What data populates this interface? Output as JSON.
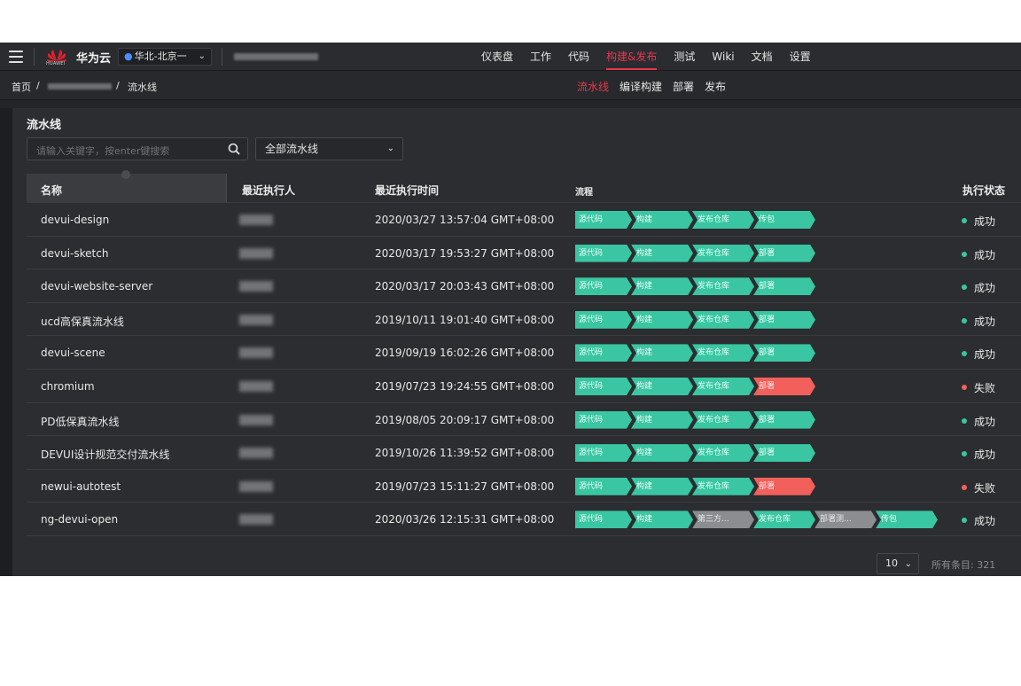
{
  "topbar": {
    "brand": "华为云",
    "logo_text": "HUAWEI",
    "region": "华北-北京一",
    "nav": [
      {
        "label": "仪表盘",
        "active": false
      },
      {
        "label": "工作",
        "active": false
      },
      {
        "label": "代码",
        "active": false
      },
      {
        "label": "构建&发布",
        "active": true
      },
      {
        "label": "测试",
        "active": false
      },
      {
        "label": "Wiki",
        "active": false
      },
      {
        "label": "文档",
        "active": false
      },
      {
        "label": "设置",
        "active": false
      }
    ]
  },
  "breadcrumb": {
    "home": "首页",
    "sep": "/",
    "current": "流水线"
  },
  "subnav": [
    {
      "label": "流水线",
      "active": true
    },
    {
      "label": "编译构建",
      "active": false
    },
    {
      "label": "部署",
      "active": false
    },
    {
      "label": "发布",
      "active": false
    }
  ],
  "panel": {
    "title": "流水线",
    "search_placeholder": "请输入关键字，按enter键搜索",
    "filter_value": "全部流水线"
  },
  "table": {
    "headers": {
      "name": "名称",
      "executor": "最近执行人",
      "time": "最近执行时间",
      "flow": "流程",
      "status": "执行状态"
    },
    "rows": [
      {
        "name": "devui-design",
        "time": "2020/03/27 13:57:04 GMT+08:00",
        "stages": [
          [
            "源代码",
            "ok"
          ],
          [
            "构建",
            "ok"
          ],
          [
            "发布仓库",
            "ok"
          ],
          [
            "传包",
            "ok"
          ]
        ],
        "status": "成功",
        "ok": true
      },
      {
        "name": "devui-sketch",
        "time": "2020/03/17 19:53:27 GMT+08:00",
        "stages": [
          [
            "源代码",
            "ok"
          ],
          [
            "构建",
            "ok"
          ],
          [
            "发布仓库",
            "ok"
          ],
          [
            "部署",
            "ok"
          ]
        ],
        "status": "成功",
        "ok": true
      },
      {
        "name": "devui-website-server",
        "time": "2020/03/17 20:03:43 GMT+08:00",
        "stages": [
          [
            "源代码",
            "ok"
          ],
          [
            "构建",
            "ok"
          ],
          [
            "发布仓库",
            "ok"
          ],
          [
            "部署",
            "ok"
          ]
        ],
        "status": "成功",
        "ok": true
      },
      {
        "name": "ucd高保真流水线",
        "time": "2019/10/11 19:01:40 GMT+08:00",
        "stages": [
          [
            "源代码",
            "ok"
          ],
          [
            "构建",
            "ok"
          ],
          [
            "发布仓库",
            "ok"
          ],
          [
            "部署",
            "ok"
          ]
        ],
        "status": "成功",
        "ok": true
      },
      {
        "name": "devui-scene",
        "time": "2019/09/19 16:02:26 GMT+08:00",
        "stages": [
          [
            "源代码",
            "ok"
          ],
          [
            "构建",
            "ok"
          ],
          [
            "发布仓库",
            "ok"
          ],
          [
            "部署",
            "ok"
          ]
        ],
        "status": "成功",
        "ok": true
      },
      {
        "name": "chromium",
        "time": "2019/07/23 19:24:55 GMT+08:00",
        "stages": [
          [
            "源代码",
            "ok"
          ],
          [
            "构建",
            "ok"
          ],
          [
            "发布仓库",
            "ok"
          ],
          [
            "部署",
            "fail"
          ]
        ],
        "status": "失败",
        "ok": false
      },
      {
        "name": "PD低保真流水线",
        "time": "2019/08/05 20:09:17 GMT+08:00",
        "stages": [
          [
            "源代码",
            "ok"
          ],
          [
            "构建",
            "ok"
          ],
          [
            "发布仓库",
            "ok"
          ],
          [
            "部署",
            "ok"
          ]
        ],
        "status": "成功",
        "ok": true
      },
      {
        "name": "DEVUI设计规范交付流水线",
        "time": "2019/10/26 11:39:52 GMT+08:00",
        "stages": [
          [
            "源代码",
            "ok"
          ],
          [
            "构建",
            "ok"
          ],
          [
            "发布仓库",
            "ok"
          ],
          [
            "部署",
            "ok"
          ]
        ],
        "status": "成功",
        "ok": true
      },
      {
        "name": "newui-autotest",
        "time": "2019/07/23 15:11:27 GMT+08:00",
        "stages": [
          [
            "源代码",
            "ok"
          ],
          [
            "构建",
            "ok"
          ],
          [
            "发布仓库",
            "ok"
          ],
          [
            "部署",
            "fail"
          ]
        ],
        "status": "失败",
        "ok": false
      },
      {
        "name": "ng-devui-open",
        "time": "2020/03/26 12:15:31 GMT+08:00",
        "stages": [
          [
            "源代码",
            "ok"
          ],
          [
            "构建",
            "ok"
          ],
          [
            "第三方...",
            "skip"
          ],
          [
            "发布仓库",
            "ok"
          ],
          [
            "部署测...",
            "skip"
          ],
          [
            "传包",
            "ok"
          ]
        ],
        "status": "成功",
        "ok": true
      }
    ]
  },
  "pager": {
    "size": "10",
    "total": "所有条目: 321"
  },
  "colors": {
    "accent": "#e9364d",
    "success": "#3ac6a2",
    "fail": "#f2605b",
    "skip": "#8b8d90",
    "bg": "#232528"
  }
}
